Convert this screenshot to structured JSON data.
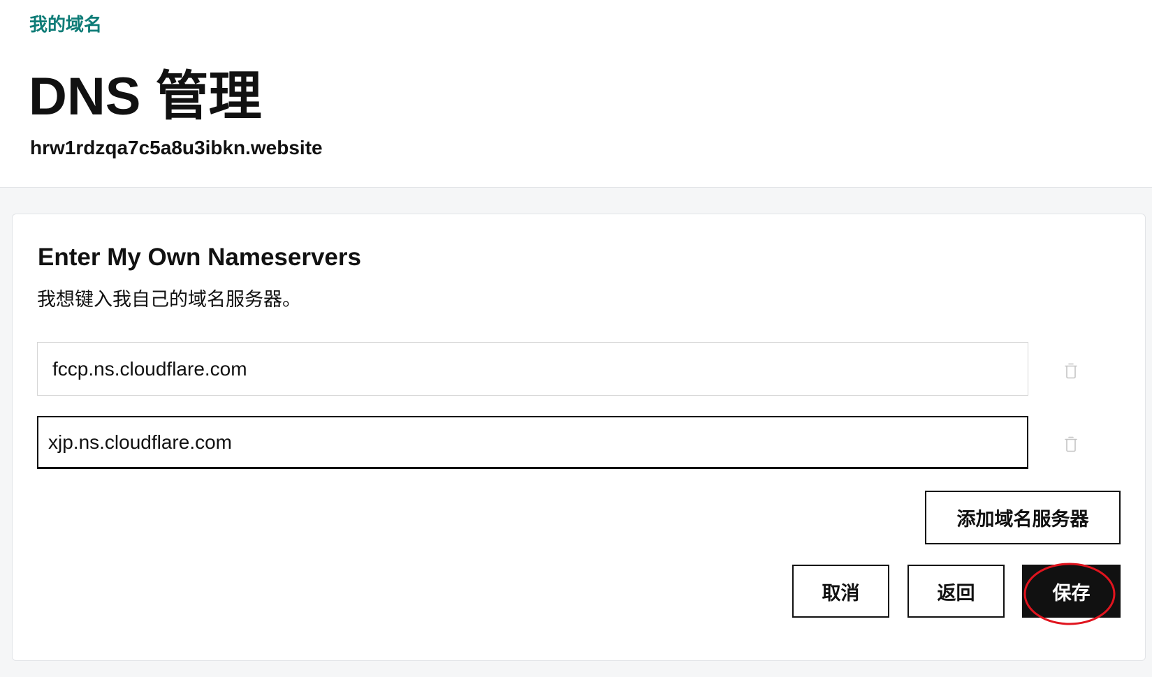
{
  "breadcrumb": {
    "label": "我的域名"
  },
  "page": {
    "title": "DNS 管理",
    "domain": "hrw1rdzqa7c5a8u3ibkn.website"
  },
  "card": {
    "heading": "Enter My Own Nameservers",
    "description": "我想键入我自己的域名服务器。",
    "nameservers": [
      {
        "value": "fccp.ns.cloudflare.com",
        "delete_icon": "trash-icon"
      },
      {
        "value": "xjp.ns.cloudflare.com",
        "delete_icon": "trash-icon"
      }
    ],
    "add_button_label": "添加域名服务器",
    "cancel_label": "取消",
    "back_label": "返回",
    "save_label": "保存"
  },
  "colors": {
    "brand": "#0e7c77",
    "primary": "#111111",
    "highlight": "#e0141e"
  }
}
